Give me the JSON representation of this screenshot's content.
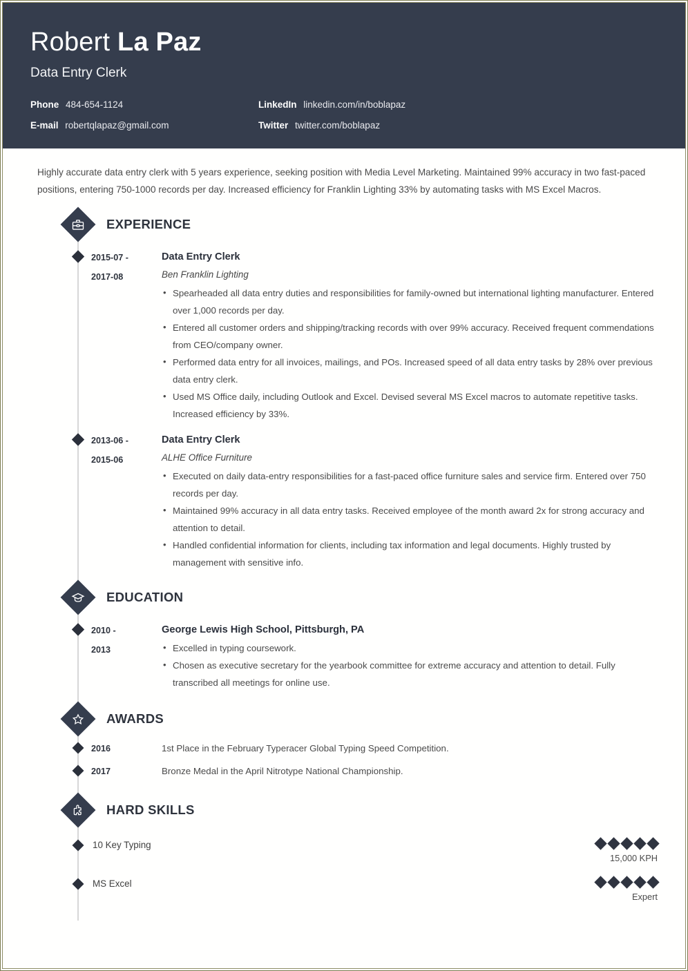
{
  "theme": {
    "header_bg": "#353d4d",
    "accent_dark": "#2b303b",
    "page_border": "#7b7a4e",
    "timeline_line": "#d7d7d7",
    "body_text": "#4a4a4a"
  },
  "header": {
    "first_name": "Robert",
    "last_name": "La Paz",
    "job_title": "Data Entry Clerk",
    "contacts": [
      {
        "label": "Phone",
        "value": "484-654-1124"
      },
      {
        "label": "LinkedIn",
        "value": "linkedin.com/in/boblapaz"
      },
      {
        "label": "E-mail",
        "value": "robertqlapaz@gmail.com"
      },
      {
        "label": "Twitter",
        "value": "twitter.com/boblapaz"
      }
    ]
  },
  "summary": "Highly accurate data entry clerk with 5 years experience, seeking position with Media Level Marketing. Maintained 99% accuracy in two fast-paced positions, entering 750-1000 records per day. Increased efficiency for Franklin Lighting 33% by automating tasks with MS Excel Macros.",
  "sections": {
    "experience": {
      "title": "EXPERIENCE",
      "icon": "briefcase-icon",
      "entries": [
        {
          "date_from": "2015-07 -",
          "date_to": "2017-08",
          "role": "Data Entry Clerk",
          "company": "Ben Franklin Lighting",
          "bullets": [
            "Spearheaded all data entry duties and responsibilities for family-owned but international lighting manufacturer. Entered over 1,000 records per day.",
            "Entered all customer orders and shipping/tracking records with over 99% accuracy. Received frequent commendations from CEO/company owner.",
            "Performed data entry for all invoices, mailings, and POs. Increased speed of all data entry tasks by 28% over previous data entry clerk.",
            "Used MS Office daily, including Outlook and Excel. Devised several MS Excel macros to automate repetitive tasks. Increased efficiency by 33%."
          ]
        },
        {
          "date_from": "2013-06 -",
          "date_to": "2015-06",
          "role": "Data Entry Clerk",
          "company": "ALHE Office Furniture",
          "bullets": [
            "Executed on daily data-entry responsibilities for a fast-paced office furniture sales and service firm. Entered over 750 records per day.",
            "Maintained 99% accuracy in all data entry tasks. Received employee of the month award 2x for strong accuracy and attention to detail.",
            "Handled confidential information for clients, including tax information and legal documents. Highly trusted by management with sensitive info."
          ]
        }
      ]
    },
    "education": {
      "title": "EDUCATION",
      "icon": "graduation-cap-icon",
      "entries": [
        {
          "date_from": "2010 -",
          "date_to": "2013",
          "school": "George Lewis High School, Pittsburgh, PA",
          "bullets": [
            "Excelled in typing coursework.",
            "Chosen as executive secretary for the yearbook committee for extreme accuracy and attention to detail. Fully transcribed all meetings for online use."
          ]
        }
      ]
    },
    "awards": {
      "title": "AWARDS",
      "icon": "star-badge-icon",
      "items": [
        {
          "year": "2016",
          "text": "1st Place in the February Typeracer Global Typing Speed Competition."
        },
        {
          "year": "2017",
          "text": "Bronze Medal in the April Nitrotype National Championship."
        }
      ]
    },
    "hard_skills": {
      "title": "HARD SKILLS",
      "icon": "puzzle-piece-icon",
      "items": [
        {
          "name": "10 Key Typing",
          "rating": 5,
          "max_rating": 5,
          "level": "15,000 KPH"
        },
        {
          "name": "MS Excel",
          "rating": 5,
          "max_rating": 5,
          "level": "Expert"
        }
      ]
    }
  }
}
